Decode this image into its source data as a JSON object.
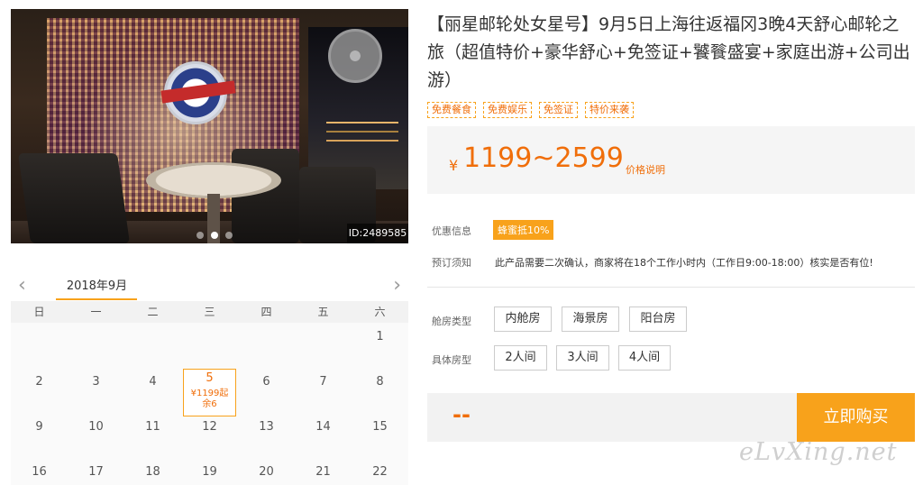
{
  "gallery": {
    "image_id": "ID:2489585",
    "slide_count": 3,
    "active_slide": 2
  },
  "calendar": {
    "month_label": "2018年9月",
    "prev_icon": "chevron-left-icon",
    "next_icon": "chevron-right-icon",
    "weekdays": [
      "日",
      "一",
      "二",
      "三",
      "四",
      "五",
      "六"
    ],
    "rows": [
      [
        "",
        "",
        "",
        "",
        "",
        "",
        "1"
      ],
      [
        "2",
        "3",
        "4",
        "5",
        "6",
        "7",
        "8"
      ],
      [
        "9",
        "10",
        "11",
        "12",
        "13",
        "14",
        "15"
      ],
      [
        "16",
        "17",
        "18",
        "19",
        "20",
        "21",
        "22"
      ]
    ],
    "selected": {
      "day": "5",
      "price": "¥1199起",
      "remaining": "余6"
    }
  },
  "product": {
    "title": "【丽星邮轮处女星号】9月5日上海往返福冈3晚4天舒心邮轮之旅（超值特价+豪华舒心+免签证+饕餮盛宴+家庭出游+公司出游）",
    "tags": [
      "免费餐食",
      "免费娱乐",
      "免签证",
      "特价来袭"
    ],
    "price_symbol": "¥",
    "price_range": "1199~2599",
    "price_note": "价格说明"
  },
  "info": {
    "promo_label": "优惠信息",
    "promo_badge": "蜂蜜抵10%",
    "notice_label": "预订须知",
    "notice_text": "此产品需要二次确认，商家将在18个工作小时内（工作日9:00-18:00）核实是否有位!"
  },
  "options": {
    "cabin_label": "舱房类型",
    "cabin_types": [
      "内舱房",
      "海景房",
      "阳台房"
    ],
    "room_label": "具体房型",
    "room_types": [
      "2人间",
      "3人间",
      "4人间"
    ]
  },
  "purchase": {
    "total": "--",
    "buy_label": "立即购买"
  },
  "watermark": "eLvXing.net",
  "colors": {
    "accent": "#f8a21b",
    "price": "#f06e0a"
  }
}
